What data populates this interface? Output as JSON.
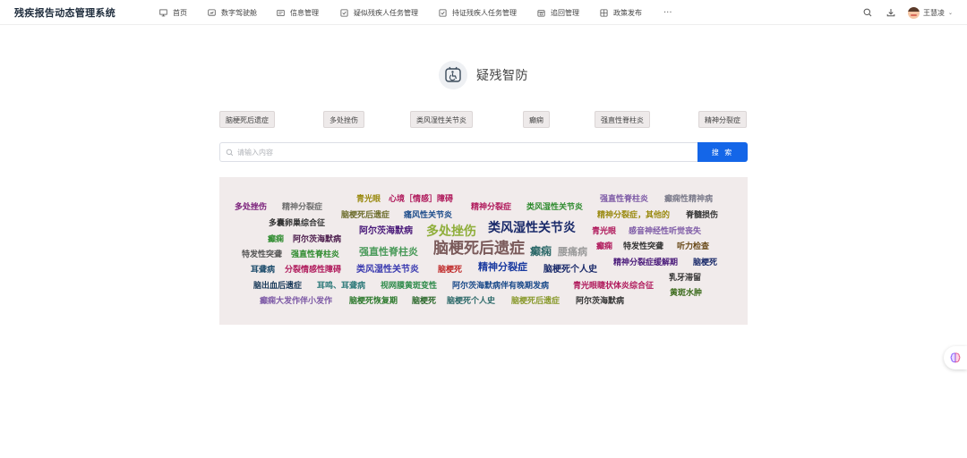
{
  "header": {
    "app_title": "残疾报告动态管理系统",
    "nav": [
      {
        "label": "首页",
        "icon": "monitor-icon"
      },
      {
        "label": "数字驾驶舱",
        "icon": "dashboard-icon"
      },
      {
        "label": "信息管理",
        "icon": "info-card-icon"
      },
      {
        "label": "疑似残疾人任务管理",
        "icon": "checkbox-icon"
      },
      {
        "label": "持证残疾人任务管理",
        "icon": "checkbox-icon"
      },
      {
        "label": "追回管理",
        "icon": "calendar-icon"
      },
      {
        "label": "政策发布",
        "icon": "grid-icon"
      }
    ],
    "more_label": "···",
    "user_name": "王慧凌",
    "caret": "⌄"
  },
  "logo": {
    "text": "疑残智防",
    "icon": "accessibility-icon"
  },
  "tags": [
    "脑梗死后遗症",
    "多处挫伤",
    "类风湿性关节炎",
    "癫痫",
    "强直性脊柱炎",
    "精神分裂症"
  ],
  "search": {
    "placeholder": "请输入内容",
    "button_label": "搜 索"
  },
  "word_cloud": [
    {
      "text": "多处挫伤",
      "color": "#7a1f7a",
      "size": 9
    },
    {
      "text": "精神分裂症",
      "color": "#6e6e6e",
      "size": 9
    },
    {
      "text": "青光眼",
      "color": "#9a8a10",
      "size": 9
    },
    {
      "text": "心境［情感］障碍",
      "color": "#b01a5c",
      "size": 9
    },
    {
      "text": "精神分裂症",
      "color": "#b01a5c",
      "size": 9
    },
    {
      "text": "类风湿性关节炎",
      "color": "#2e8b2e",
      "size": 9
    },
    {
      "text": "强直性脊柱炎",
      "color": "#7d5aa6",
      "size": 9
    },
    {
      "text": "癫痫性精神病",
      "color": "#7a7a8a",
      "size": 9
    },
    {
      "text": "脑梗死后遗症",
      "color": "#6e6e2e",
      "size": 9
    },
    {
      "text": "痛风性关节炎",
      "color": "#1a4a8a",
      "size": 9
    },
    {
      "text": "精神分裂症，其他的",
      "color": "#9a8a10",
      "size": 9
    },
    {
      "text": "脊髓损伤",
      "color": "#333333",
      "size": 9
    },
    {
      "text": "多囊卵巢综合征",
      "color": "#333333",
      "size": 9
    },
    {
      "text": "阿尔茨海默病",
      "color": "#4a1a7a",
      "size": 10
    },
    {
      "text": "多处挫伤",
      "color": "#8fae3a",
      "size": 14
    },
    {
      "text": "类风湿性关节炎",
      "color": "#1a2a6a",
      "size": 14
    },
    {
      "text": "青光眼",
      "color": "#b01a5c",
      "size": 9
    },
    {
      "text": "感音神经性听觉丧失",
      "color": "#7d5aa6",
      "size": 9
    },
    {
      "text": "癫痫",
      "color": "#2e8b2e",
      "size": 9
    },
    {
      "text": "阿尔茨海默病",
      "color": "#4a1a4a",
      "size": 9
    },
    {
      "text": "强直性脊柱炎",
      "color": "#4a9a5a",
      "size": 11
    },
    {
      "text": "脑梗死后遗症",
      "color": "#7a5a5a",
      "size": 17
    },
    {
      "text": "癫痫",
      "color": "#2e6a6a",
      "size": 12
    },
    {
      "text": "腰痛病",
      "color": "#9a9a9a",
      "size": 11
    },
    {
      "text": "癫痫",
      "color": "#b01a5c",
      "size": 9
    },
    {
      "text": "特发性突聋",
      "color": "#333333",
      "size": 9
    },
    {
      "text": "听力检查",
      "color": "#6a4a1a",
      "size": 9
    },
    {
      "text": "特发性突聋",
      "color": "#555555",
      "size": 9
    },
    {
      "text": "强直性脊柱炎",
      "color": "#2e8b2e",
      "size": 9
    },
    {
      "text": "精神分裂症缓解期",
      "color": "#4a1a7a",
      "size": 9
    },
    {
      "text": "脑梗死",
      "color": "#1a2a6a",
      "size": 9
    },
    {
      "text": "耳聋病",
      "color": "#1a4a6a",
      "size": 9
    },
    {
      "text": "分裂情感性障碍",
      "color": "#b01a5c",
      "size": 9
    },
    {
      "text": "类风湿性关节炎",
      "color": "#3a3ab0",
      "size": 10
    },
    {
      "text": "脑梗死",
      "color": "#c02a2a",
      "size": 9
    },
    {
      "text": "精神分裂症",
      "color": "#1a3aa0",
      "size": 11
    },
    {
      "text": "脑梗死个人史",
      "color": "#1a2a6a",
      "size": 10
    },
    {
      "text": "乳牙滞留",
      "color": "#333333",
      "size": 9
    },
    {
      "text": "脑出血后遗症",
      "color": "#1a3a5a",
      "size": 9
    },
    {
      "text": "耳鸣、耳聋病",
      "color": "#2e7a7a",
      "size": 9
    },
    {
      "text": "视网膜黄斑变性",
      "color": "#2e8b4a",
      "size": 9
    },
    {
      "text": "阿尔茨海默病伴有晚期发病",
      "color": "#1a4a8a",
      "size": 9
    },
    {
      "text": "青光眼睫状体炎综合征",
      "color": "#b01a5c",
      "size": 9
    },
    {
      "text": "黄斑水肿",
      "color": "#3a6a1a",
      "size": 9
    },
    {
      "text": "癫痫大发作伴小发作",
      "color": "#7d5aa6",
      "size": 9
    },
    {
      "text": "脑梗死恢复期",
      "color": "#2e7a2e",
      "size": 9
    },
    {
      "text": "脑梗死",
      "color": "#2e6a2e",
      "size": 9
    },
    {
      "text": "脑梗死个人史",
      "color": "#2e6a6a",
      "size": 9
    },
    {
      "text": "脑梗死后遗症",
      "color": "#8a9a2e",
      "size": 9
    },
    {
      "text": "阿尔茨海默病",
      "color": "#333333",
      "size": 9
    }
  ],
  "floating_button": {
    "icon": "brain-icon"
  }
}
